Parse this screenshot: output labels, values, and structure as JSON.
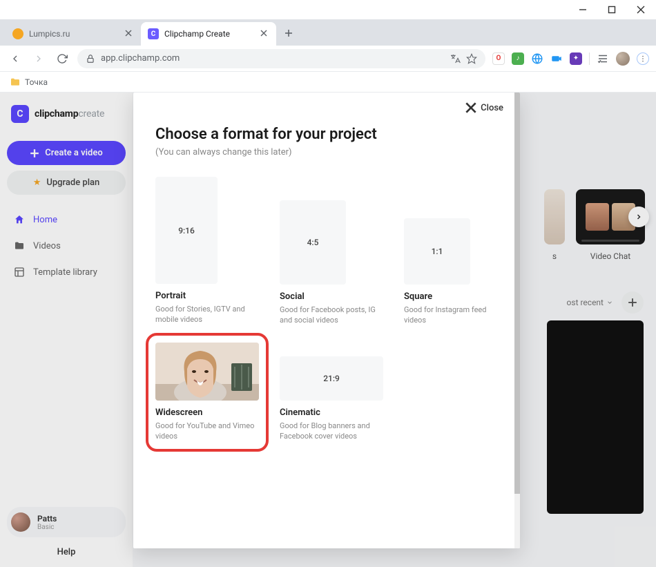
{
  "window": {
    "tabs": [
      {
        "title": "Lumpics.ru",
        "active": false
      },
      {
        "title": "Clipchamp Create",
        "active": true
      }
    ]
  },
  "omnibox": {
    "url": "app.clipchamp.com"
  },
  "bookmarks": {
    "item1": "Точка"
  },
  "sidebar": {
    "brand_main": "clipchamp",
    "brand_sub": "create",
    "create_btn": "Create a video",
    "upgrade_btn": "Upgrade plan",
    "nav": {
      "home": "Home",
      "videos": "Videos",
      "templates": "Template library"
    },
    "user": {
      "name": "Patts",
      "plan": "Basic"
    },
    "help": "Help"
  },
  "main": {
    "templates": {
      "t1": "s",
      "t2": "Video Chat"
    },
    "sort": "ost recent"
  },
  "modal": {
    "close": "Close",
    "title": "Choose a format for your project",
    "subtitle": "(You can always change this later)",
    "formats": {
      "portrait": {
        "ratio": "9:16",
        "name": "Portrait",
        "desc": "Good for Stories, IGTV and mobile videos"
      },
      "social": {
        "ratio": "4:5",
        "name": "Social",
        "desc": "Good for Facebook posts, IG and social videos"
      },
      "square": {
        "ratio": "1:1",
        "name": "Square",
        "desc": "Good for Instagram feed videos"
      },
      "wide": {
        "name": "Widescreen",
        "desc": "Good for YouTube and Vimeo videos"
      },
      "cine": {
        "ratio": "21:9",
        "name": "Cinematic",
        "desc": "Good for Blog banners and Facebook cover videos"
      }
    }
  }
}
